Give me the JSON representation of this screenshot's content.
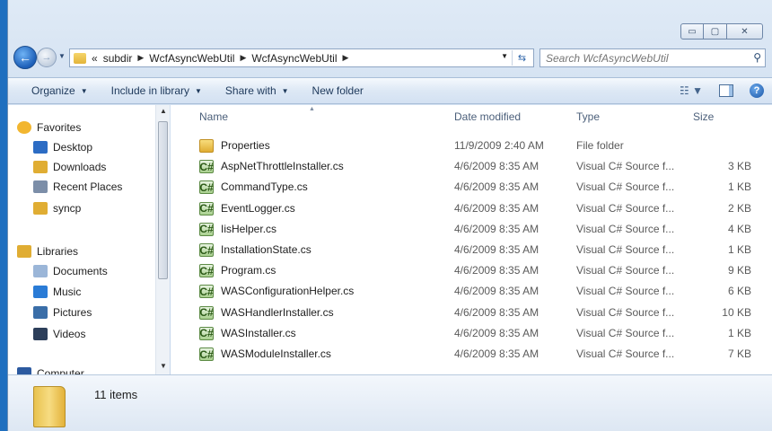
{
  "window": {
    "minimize_glyph": "▭",
    "maximize_glyph": "▢",
    "close_glyph": "✕"
  },
  "nav": {
    "back_glyph": "←",
    "forward_glyph": "→",
    "recent_glyph": "▼"
  },
  "address": {
    "overflow": "«",
    "crumbs": [
      "subdir",
      "WcfAsyncWebUtil",
      "WcfAsyncWebUtil"
    ],
    "separator": "▶",
    "dropdown_glyph": "▼",
    "refresh_glyph": "⇆"
  },
  "search": {
    "placeholder": "Search WcfAsyncWebUtil",
    "icon": "search-icon"
  },
  "toolbar": {
    "organize": "Organize",
    "include_in_library": "Include in library",
    "share_with": "Share with",
    "new_folder": "New folder",
    "dd": "▼",
    "views_glyph": "☷ ▼",
    "help_glyph": "?"
  },
  "sidebar": {
    "items": [
      {
        "label": "Favorites",
        "icon": "star-icon",
        "color": "#f2b630"
      },
      {
        "label": "Desktop",
        "icon": "desktop-icon",
        "color": "#2c6cc4"
      },
      {
        "label": "Downloads",
        "icon": "downloads-icon",
        "color": "#e0ad33"
      },
      {
        "label": "Recent Places",
        "icon": "recent-places-icon",
        "color": "#7c8ea8"
      },
      {
        "label": "syncp",
        "icon": "folder-icon",
        "color": "#e0ad33"
      },
      {
        "label": "Libraries",
        "icon": "libraries-icon",
        "color": "#e0ad33"
      },
      {
        "label": "Documents",
        "icon": "documents-icon",
        "color": "#9bb6d8"
      },
      {
        "label": "Music",
        "icon": "music-icon",
        "color": "#2a7bd6"
      },
      {
        "label": "Pictures",
        "icon": "pictures-icon",
        "color": "#3a6ea8"
      },
      {
        "label": "Videos",
        "icon": "videos-icon",
        "color": "#2c3e5a"
      },
      {
        "label": "Computer",
        "icon": "computer-icon",
        "color": "#2c5aa0"
      }
    ],
    "scroll_up": "▲",
    "scroll_down": "▼"
  },
  "columns": {
    "name": "Name",
    "date": "Date modified",
    "type": "Type",
    "size": "Size",
    "sort_glyph": "▲"
  },
  "files": [
    {
      "name": "Properties",
      "date": "11/9/2009 2:40 AM",
      "type": "File folder",
      "size": "",
      "kind": "folder"
    },
    {
      "name": "AspNetThrottleInstaller.cs",
      "date": "4/6/2009 8:35 AM",
      "type": "Visual C# Source f...",
      "size": "3 KB",
      "kind": "cs"
    },
    {
      "name": "CommandType.cs",
      "date": "4/6/2009 8:35 AM",
      "type": "Visual C# Source f...",
      "size": "1 KB",
      "kind": "cs"
    },
    {
      "name": "EventLogger.cs",
      "date": "4/6/2009 8:35 AM",
      "type": "Visual C# Source f...",
      "size": "2 KB",
      "kind": "cs"
    },
    {
      "name": "IisHelper.cs",
      "date": "4/6/2009 8:35 AM",
      "type": "Visual C# Source f...",
      "size": "4 KB",
      "kind": "cs"
    },
    {
      "name": "InstallationState.cs",
      "date": "4/6/2009 8:35 AM",
      "type": "Visual C# Source f...",
      "size": "1 KB",
      "kind": "cs"
    },
    {
      "name": "Program.cs",
      "date": "4/6/2009 8:35 AM",
      "type": "Visual C# Source f...",
      "size": "9 KB",
      "kind": "cs"
    },
    {
      "name": "WASConfigurationHelper.cs",
      "date": "4/6/2009 8:35 AM",
      "type": "Visual C# Source f...",
      "size": "6 KB",
      "kind": "cs"
    },
    {
      "name": "WASHandlerInstaller.cs",
      "date": "4/6/2009 8:35 AM",
      "type": "Visual C# Source f...",
      "size": "10 KB",
      "kind": "cs"
    },
    {
      "name": "WASInstaller.cs",
      "date": "4/6/2009 8:35 AM",
      "type": "Visual C# Source f...",
      "size": "1 KB",
      "kind": "cs"
    },
    {
      "name": "WASModuleInstaller.cs",
      "date": "4/6/2009 8:35 AM",
      "type": "Visual C# Source f...",
      "size": "7 KB",
      "kind": "cs"
    }
  ],
  "status": {
    "item_count": "11 items"
  }
}
